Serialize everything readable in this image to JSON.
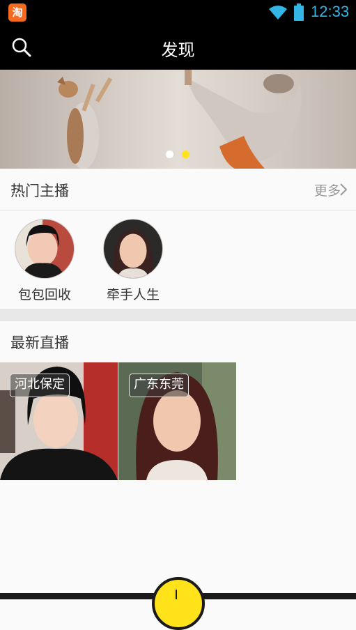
{
  "status_bar": {
    "app_icon_glyph": "淘",
    "time": "12:33",
    "icons": [
      "taobao-notification-icon",
      "wifi-icon",
      "battery-icon"
    ],
    "time_color": "#33b5e5"
  },
  "header": {
    "title": "发现",
    "search_icon": "search-icon"
  },
  "banner": {
    "image": "squirrels-photo",
    "pager_dots": 2,
    "active_dot": 2,
    "active_dot_color": "#ffe21a"
  },
  "hot_anchors": {
    "title": "热门主播",
    "more_label": "更多",
    "items": [
      {
        "name": "包包回收",
        "avatar": "avatar-woman-black-hair-red-background"
      },
      {
        "name": "牵手人生",
        "avatar": "avatar-woman-dark-background"
      }
    ]
  },
  "latest_live": {
    "title": "最新直播",
    "items": [
      {
        "location": "河北保定",
        "thumbnail": "woman-black-jacket"
      },
      {
        "location": "广东东莞",
        "thumbnail": "woman-red-hair"
      }
    ]
  },
  "bottom": {
    "record_button_color": "#ffe21a"
  }
}
